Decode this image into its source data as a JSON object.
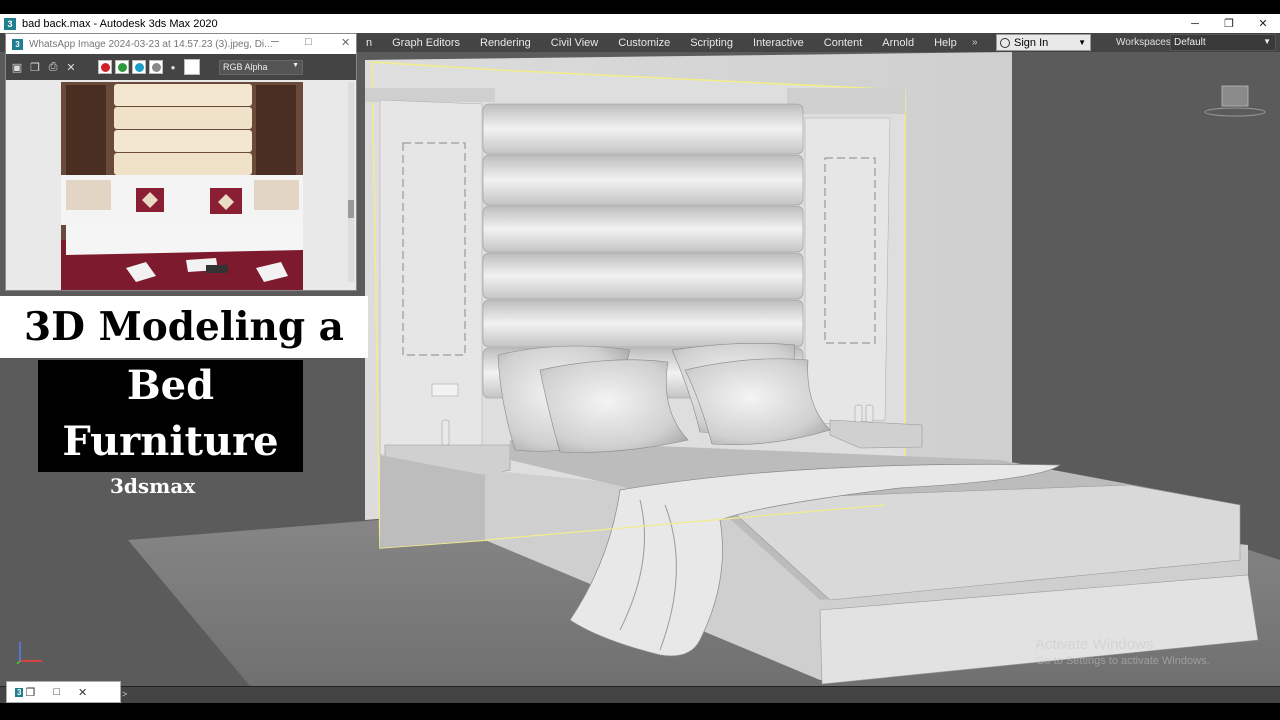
{
  "window": {
    "title": "bad back.max - Autodesk 3ds Max 2020",
    "app_icon": "3",
    "controls": [
      "─",
      "❐",
      "✕"
    ]
  },
  "menubar": {
    "items": [
      "n",
      "Graph Editors",
      "Rendering",
      "Civil View",
      "Customize",
      "Scripting",
      "Interactive",
      "Content",
      "Arnold",
      "Help"
    ],
    "overflow": "»",
    "signin_label": "Sign In",
    "workspaces_label": "Workspaces:",
    "workspace_value": "Default"
  },
  "image_viewer": {
    "title": "WhatsApp Image 2024-03-23 at 14.57.23 (3).jpeg, Di...",
    "app_icon": "3",
    "channel_select": "RGB Alpha",
    "swatch_colors": [
      "#d4202a",
      "#2a9a3a",
      "#1aa0c8",
      "#888888"
    ]
  },
  "overlay": {
    "line1": "3D Modeling a",
    "line2": "Bed",
    "line3": "Furniture",
    "line4": "3dsmax"
  },
  "watermark": {
    "title": "Activate Windows",
    "subtitle": "Go to Settings to activate Windows."
  },
  "minibar": {
    "controls": [
      "3",
      "❐",
      "□",
      "✕"
    ]
  },
  "colors": {
    "viewport_bg": "#5b5b5b",
    "menubar_bg": "#444444",
    "selection": "#f2ec8a",
    "model_gray": "#d6d6d6"
  }
}
